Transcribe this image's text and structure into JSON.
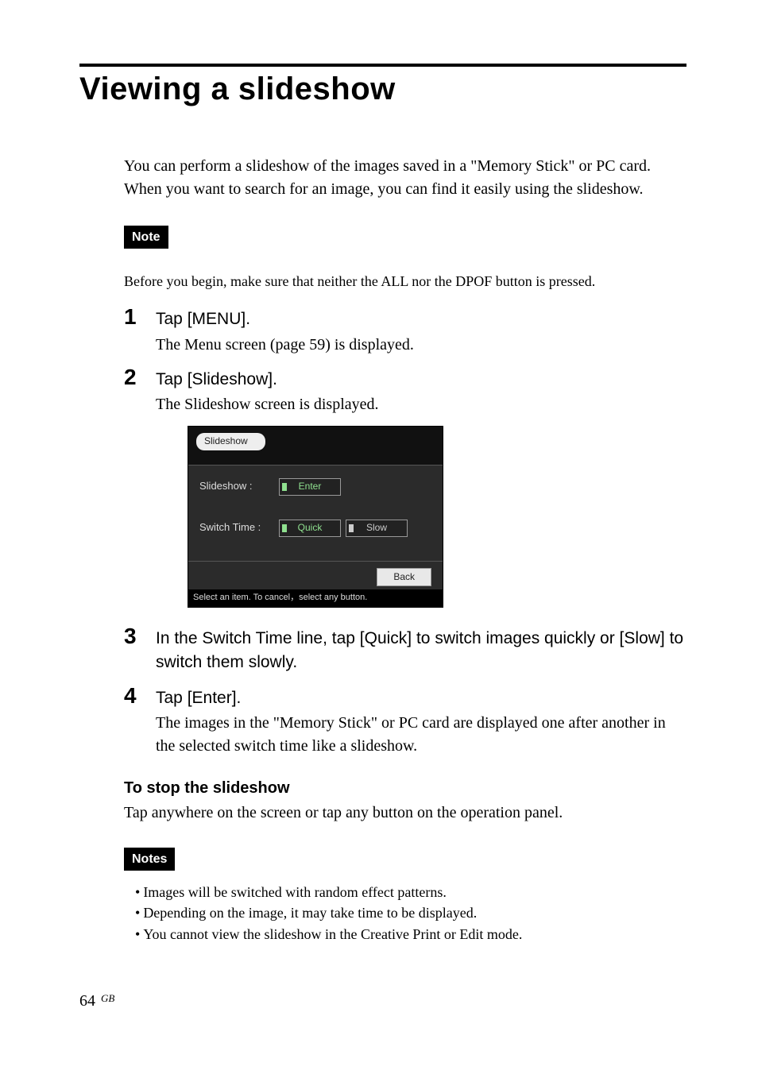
{
  "title": "Viewing a slideshow",
  "intro": "You can perform a slideshow of the images saved in a \"Memory Stick\" or PC card.  When you want to search for an image, you can find it easily using the slideshow.",
  "note_label": "Note",
  "note1": "Before you begin, make sure that neither the ALL nor the DPOF button is pressed.",
  "steps": {
    "s1_num": "1",
    "s1_title": "Tap [MENU].",
    "s1_body": "The Menu screen (page 59) is displayed.",
    "s2_num": "2",
    "s2_title": "Tap [Slideshow].",
    "s2_body": "The Slideshow screen is displayed.",
    "s3_num": "3",
    "s3_title": "In the Switch Time line, tap [Quick] to switch images quickly or [Slow] to switch them slowly.",
    "s4_num": "4",
    "s4_title": "Tap [Enter].",
    "s4_body": "The images in the \"Memory Stick\" or PC card are displayed one after another in the selected switch time like a slideshow."
  },
  "stop_heading": "To stop the slideshow",
  "stop_body": "Tap anywhere on the screen or tap any button on the operation panel.",
  "notes_label": "Notes",
  "notes_bullets": {
    "b1": "Images will be switched with random effect patterns.",
    "b2": "Depending on the image, it may take time to be displayed.",
    "b3": "You cannot view the slideshow in the Creative Print or Edit mode."
  },
  "ui": {
    "tab": "Slideshow",
    "row1_label": "Slideshow :",
    "row1_btn": "Enter",
    "row2_label": "Switch Time :",
    "row2_btn1": "Quick",
    "row2_btn2": "Slow",
    "back": "Back",
    "hint": "Select an item. To cancel，select any button."
  },
  "page": {
    "num": "64",
    "region": "GB"
  }
}
